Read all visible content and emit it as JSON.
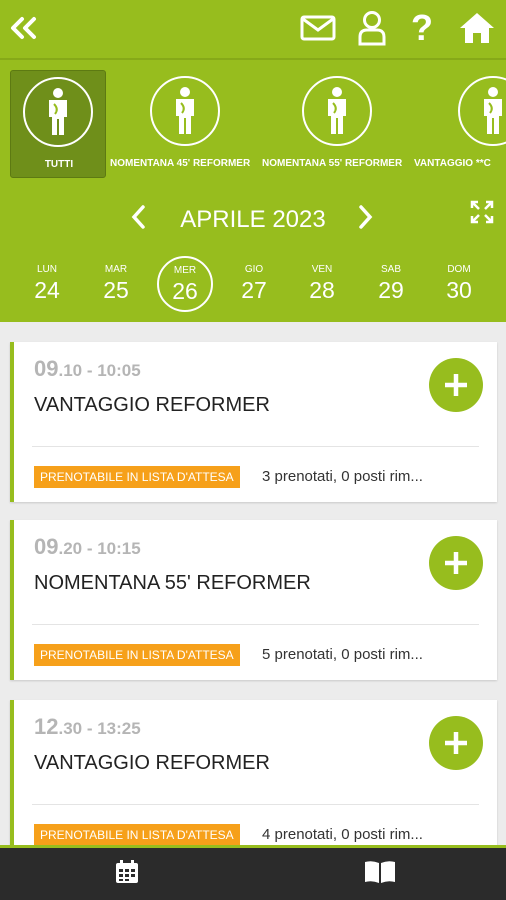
{
  "top_bar": {
    "icons": [
      "back-icon",
      "mail-icon",
      "user-icon",
      "help-icon",
      "home-icon"
    ],
    "help_glyph": "?"
  },
  "categories": [
    {
      "label": "TUTTI",
      "selected": true
    },
    {
      "label": "NOMENTANA 45' REFORMER",
      "selected": false
    },
    {
      "label": "NOMENTANA 55' REFORMER",
      "selected": false
    },
    {
      "label": "VANTAGGIO **C",
      "selected": false
    }
  ],
  "calendar": {
    "month": "APRILE 2023",
    "days": [
      {
        "weekday": "LUN",
        "day": "24"
      },
      {
        "weekday": "MAR",
        "day": "25"
      },
      {
        "weekday": "MER",
        "day": "26",
        "selected": true
      },
      {
        "weekday": "GIO",
        "day": "27"
      },
      {
        "weekday": "VEN",
        "day": "28"
      },
      {
        "weekday": "SAB",
        "day": "29"
      },
      {
        "weekday": "DOM",
        "day": "30"
      }
    ]
  },
  "classes": [
    {
      "hour": "09",
      "time_rest": ".10 - 10:05",
      "name": "VANTAGGIO REFORMER",
      "badge": "PRENOTABILE IN LISTA D'ATTESA",
      "availability": "3 prenotati, 0 posti rim..."
    },
    {
      "hour": "09",
      "time_rest": ".20 - 10:15",
      "name": "NOMENTANA 55' REFORMER",
      "badge": "PRENOTABILE IN LISTA D'ATTESA",
      "availability": "5 prenotati, 0 posti rim..."
    },
    {
      "hour": "12",
      "time_rest": ".30 - 13:25",
      "name": "VANTAGGIO REFORMER",
      "badge": "PRENOTABILE IN LISTA D'ATTESA",
      "availability": "4 prenotati, 0 posti rim..."
    }
  ],
  "colors": {
    "brand_green": "#97bd1e",
    "badge_orange": "#f6a01a",
    "bottom_bar": "#2b2b2b"
  },
  "bottom_tabs": [
    "calendar-icon",
    "book-icon"
  ]
}
